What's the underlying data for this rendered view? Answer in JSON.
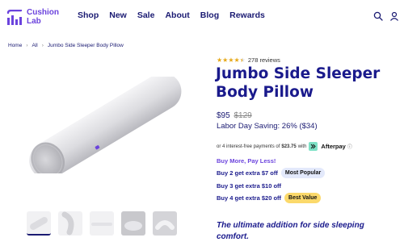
{
  "brand": {
    "name_line1": "Cushion",
    "name_line2": "Lab"
  },
  "nav": [
    {
      "label": "Shop"
    },
    {
      "label": "New"
    },
    {
      "label": "Sale"
    },
    {
      "label": "About"
    },
    {
      "label": "Blog"
    },
    {
      "label": "Rewards"
    }
  ],
  "breadcrumb": [
    "Home",
    "All",
    "Jumbo Side Sleeper Body Pillow"
  ],
  "product": {
    "rating_stars": 4.5,
    "reviews": "278 reviews",
    "title": "Jumbo Side Sleeper Body Pillow",
    "price": "$95",
    "compare_price": "$129",
    "saving": "Labor Day Saving: 26% ($34)"
  },
  "afterpay": {
    "prefix": "or 4 interest-free payments of",
    "amount": "$23.75",
    "with": "with",
    "brand": "Afterpay",
    "info": "ⓘ"
  },
  "buy_more": {
    "heading": "Buy More, Pay Less!",
    "offers": [
      {
        "text": "Buy 2 get extra $7 off",
        "tag": "Most Popular"
      },
      {
        "text": "Buy 3 get extra $10 off",
        "tag": ""
      },
      {
        "text": "Buy 4 get extra $20 off",
        "tag": "Best Value"
      }
    ]
  },
  "tagline": "The ultimate addition for side sleeping comfort.",
  "colors": {
    "accent": "#6b43dd",
    "navy": "#1a1a8c",
    "star": "#e6a817",
    "afterpay": "#7ee1c6",
    "best_value": "#fbd96b"
  },
  "icons": [
    "search-icon",
    "user-icon"
  ]
}
